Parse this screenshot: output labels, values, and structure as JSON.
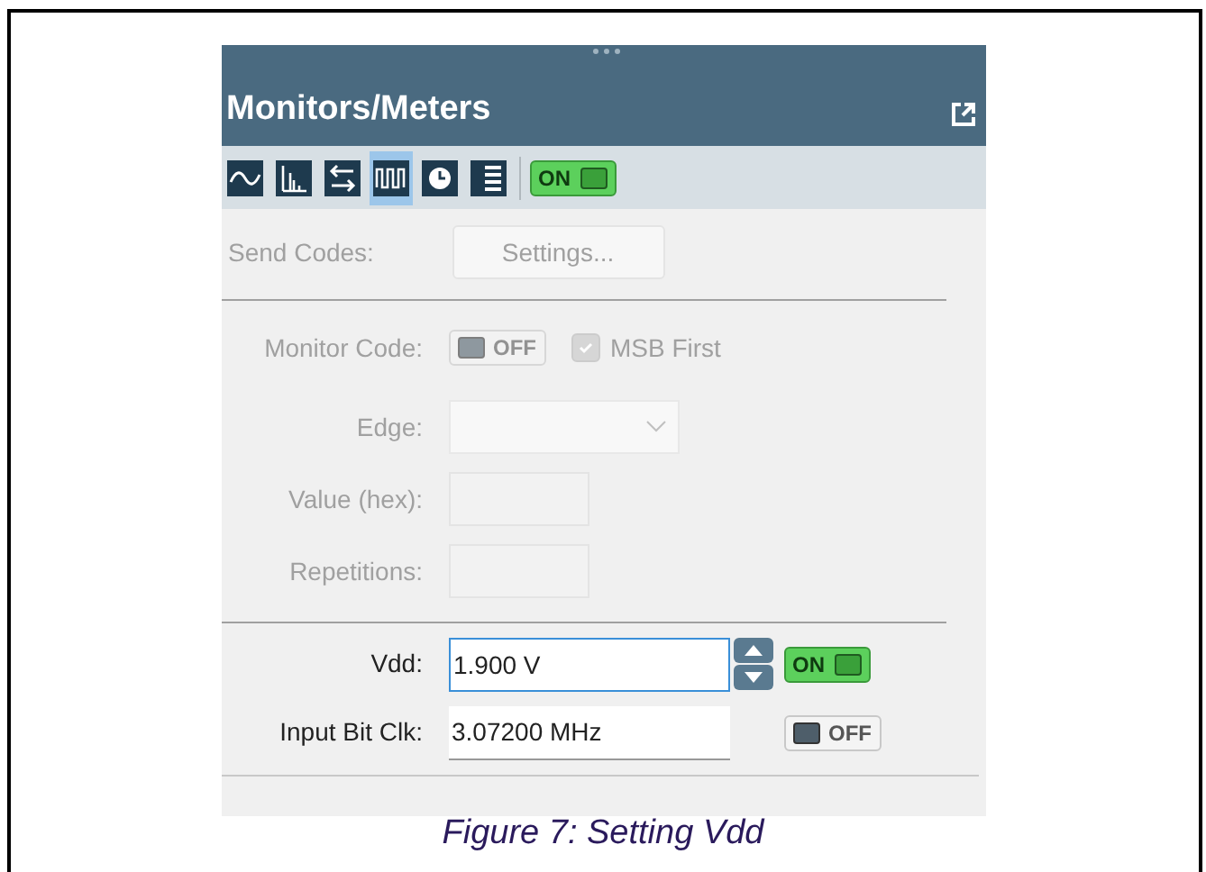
{
  "panel": {
    "title": "Monitors/Meters"
  },
  "toolbar": {
    "tools": [
      {
        "kind": "wave",
        "selected": false
      },
      {
        "kind": "histogram",
        "selected": false
      },
      {
        "kind": "arrows",
        "selected": false
      },
      {
        "kind": "pulses",
        "selected": true
      },
      {
        "kind": "clock",
        "selected": false
      },
      {
        "kind": "list",
        "selected": false
      }
    ],
    "toggle": {
      "on": true,
      "label": "ON"
    }
  },
  "send_codes": {
    "label": "Send Codes:",
    "button": "Settings...",
    "disabled": true
  },
  "monitor": {
    "disabled": true,
    "code_label": "Monitor Code:",
    "code_toggle": {
      "on": false,
      "label": "OFF"
    },
    "msb_first": {
      "label": "MSB First",
      "checked": true
    },
    "edge_label": "Edge:",
    "value_label": "Value (hex):",
    "repetitions_label": "Repetitions:"
  },
  "supply": [
    {
      "label": "Vdd:",
      "value": "1.900 V",
      "focused": true,
      "spinner": true,
      "toggle": {
        "on": true,
        "label": "ON"
      }
    },
    {
      "label": "Input Bit Clk:",
      "value": "3.07200 MHz",
      "focused": false,
      "spinner": false,
      "toggle": {
        "on": false,
        "label": "OFF"
      }
    }
  ],
  "caption": "Figure 7: Setting Vdd"
}
